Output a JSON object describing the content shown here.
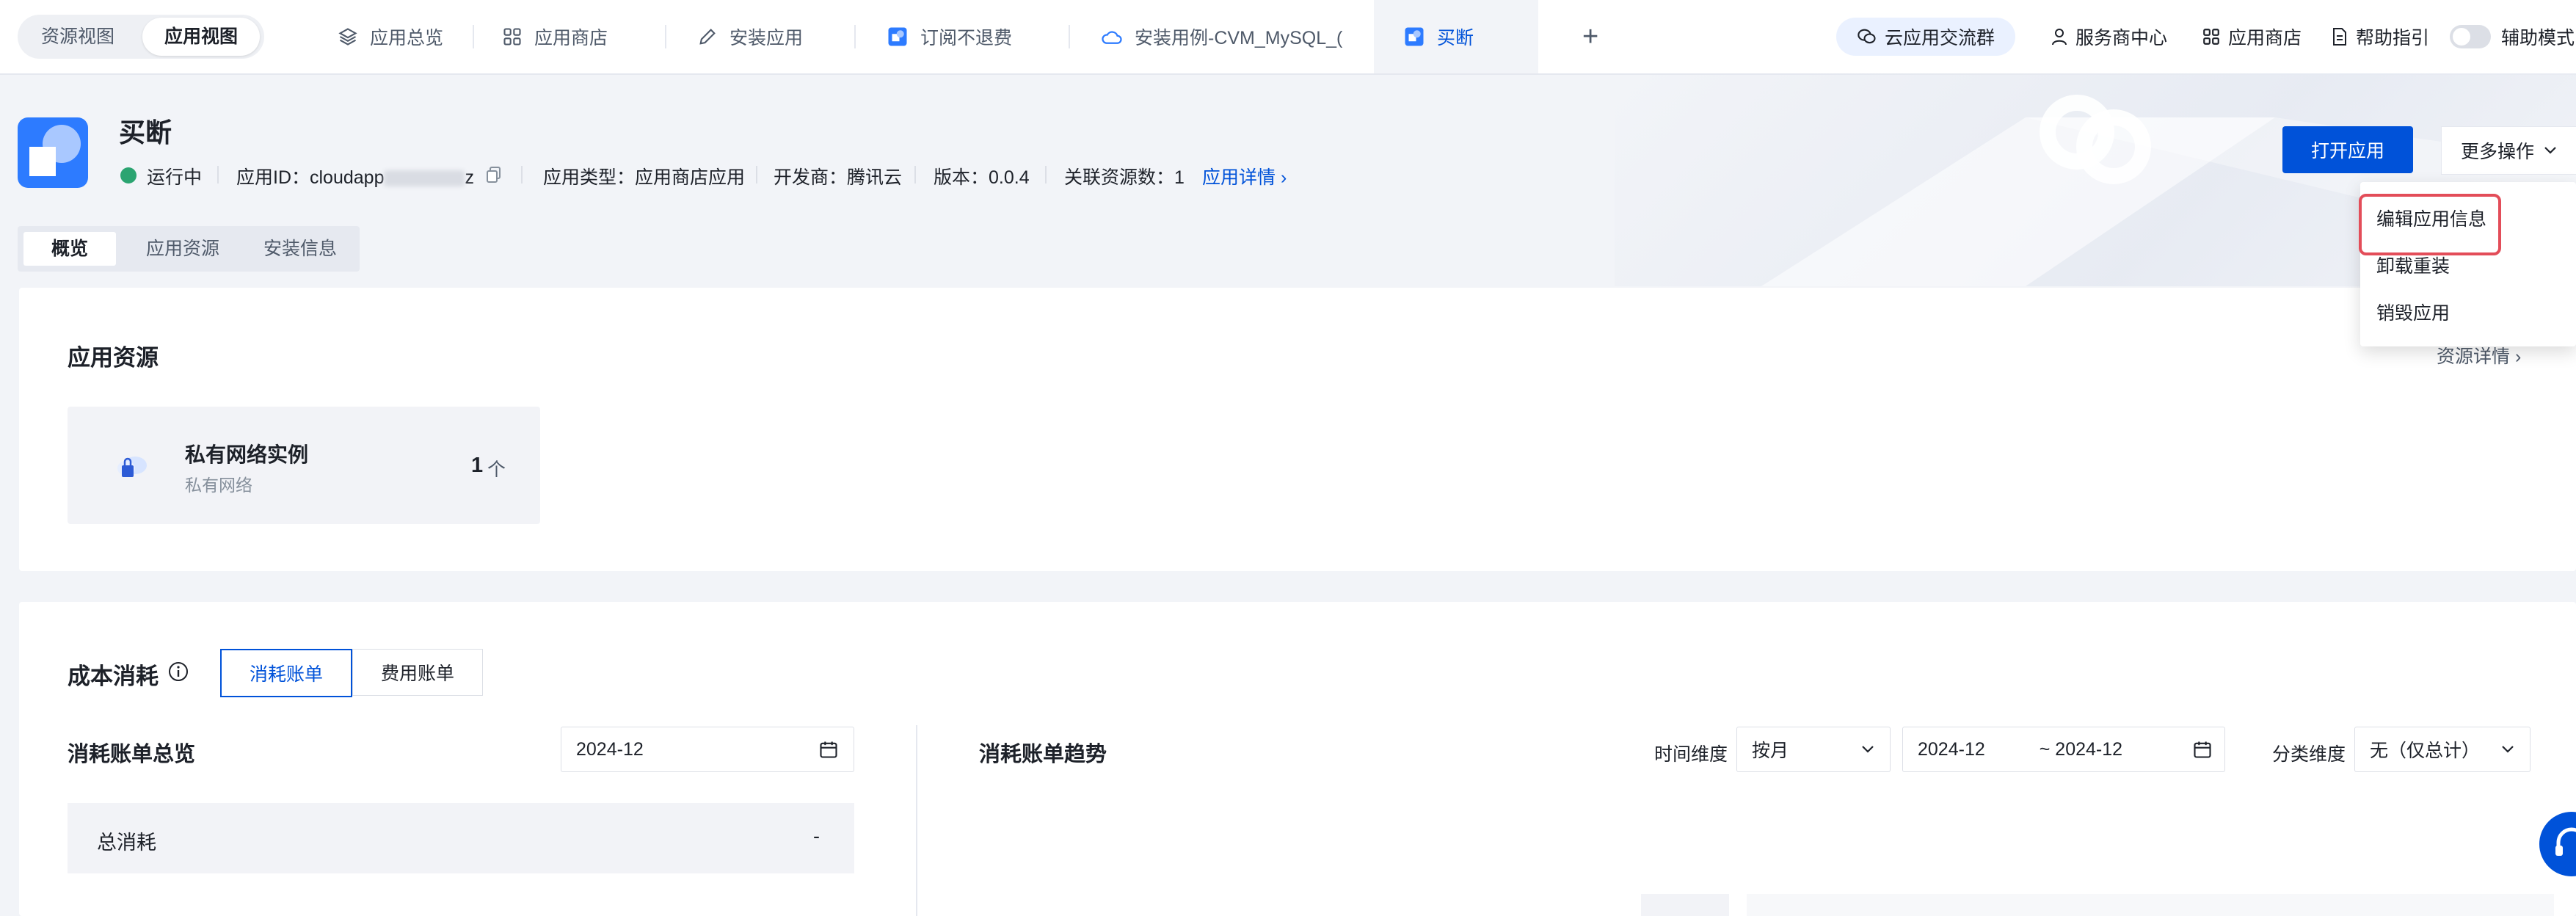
{
  "topbar": {
    "view_toggle": [
      "资源视图",
      "应用视图"
    ],
    "tabs": [
      {
        "label": "应用总览",
        "icon": "layers-icon"
      },
      {
        "label": "应用商店",
        "icon": "grid-icon"
      },
      {
        "label": "安装应用",
        "icon": "pen-icon"
      },
      {
        "label": "订阅不退费",
        "icon": "app-icon"
      },
      {
        "label": "安装用例-CVM_MySQL_(",
        "icon": "cloud-icon"
      },
      {
        "label": "买断",
        "icon": "app-icon"
      }
    ],
    "add_tab": "+",
    "community_pill": "云应用交流群",
    "links": [
      "服务商中心",
      "应用商店",
      "帮助指引"
    ],
    "assist_mode_label": "辅助模式"
  },
  "app": {
    "title": "买断",
    "status": "运行中",
    "id_label": "应用ID：cloudapp",
    "id_tail": "z",
    "type": "应用类型：应用商店应用",
    "developer": "开发商：腾讯云",
    "version": "版本：0.0.4",
    "related": "关联资源数：1",
    "detail_link": "应用详情 ›",
    "open_button": "打开应用",
    "more_button": "更多操作"
  },
  "more_menu": [
    "编辑应用信息",
    "卸载重装",
    "销毁应用"
  ],
  "page_tabs": [
    "概览",
    "应用资源",
    "安装信息"
  ],
  "resources": {
    "title": "应用资源",
    "detail_link": "资源详情 ›",
    "item_name": "私有网络实例",
    "item_sub": "私有网络",
    "count": "1",
    "unit": "个"
  },
  "cost": {
    "title": "成本消耗",
    "tabs": [
      "消耗账单",
      "费用账单"
    ],
    "overview_title": "消耗账单总览",
    "month": "2024-12",
    "trend_title": "消耗账单趋势",
    "time_dim_label": "时间维度",
    "time_dim_value": "按月",
    "range_start": "2024-12",
    "range_end": "~ 2024-12",
    "category_dim_label": "分类维度",
    "category_dim_value": "无（仅总计）",
    "total_label": "总消耗",
    "total_value": "-"
  },
  "colors": {
    "brand": "#0052d9",
    "status_running": "#2ba471",
    "highlight_border": "#e34d59"
  }
}
